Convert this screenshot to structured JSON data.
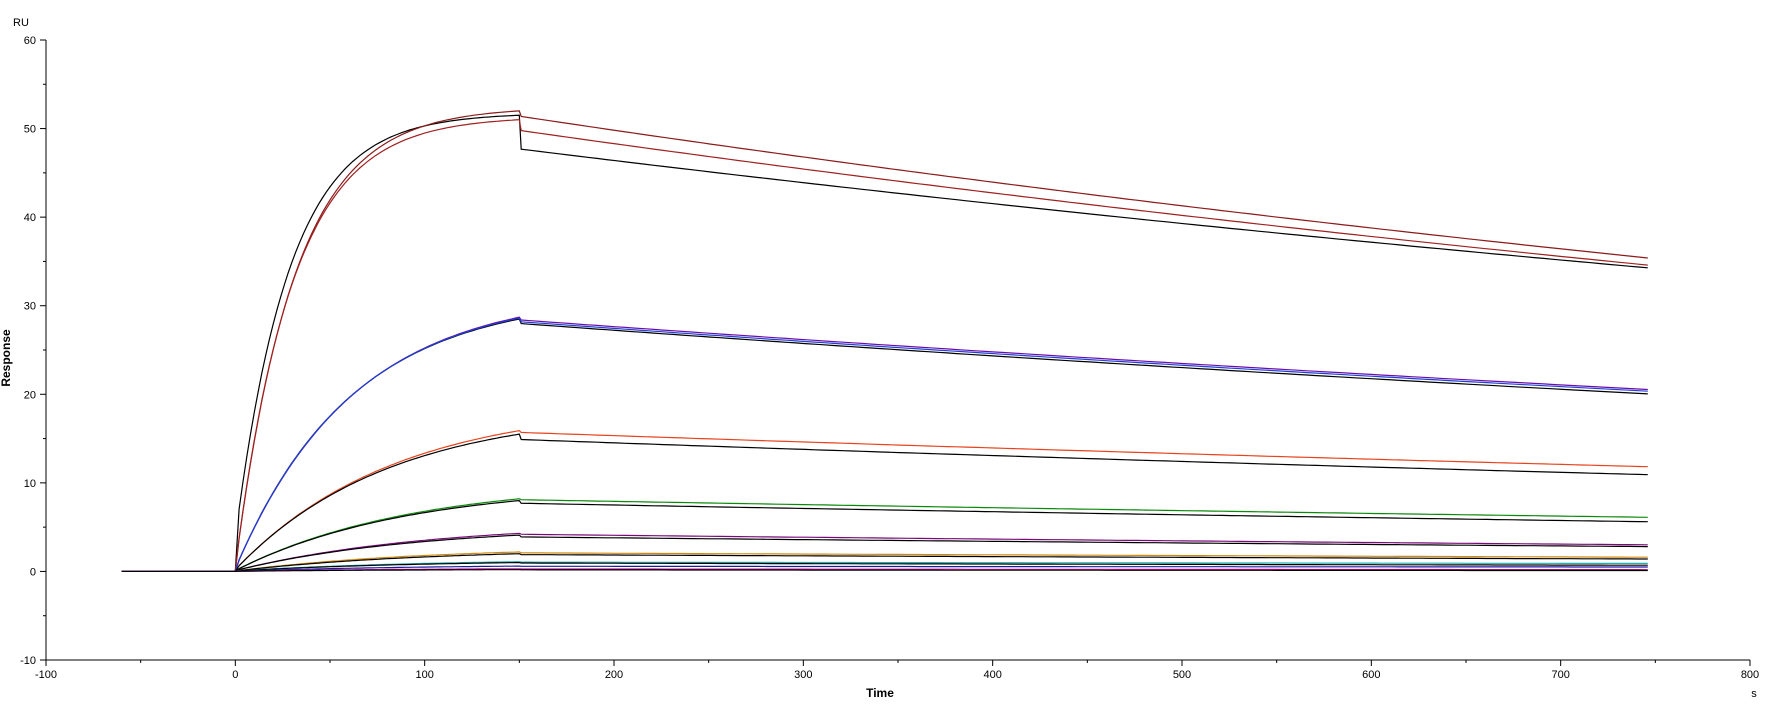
{
  "chart_data": {
    "type": "line",
    "title": "",
    "xlabel": "Time",
    "ylabel": "Response",
    "x_unit": "s",
    "y_unit": "RU",
    "xlim": [
      -100,
      800
    ],
    "ylim": [
      -10,
      60
    ],
    "x_ticks": [
      -100,
      0,
      100,
      200,
      300,
      400,
      500,
      600,
      700,
      800
    ],
    "y_ticks": [
      -10,
      0,
      10,
      20,
      30,
      40,
      50,
      60
    ],
    "grid": false,
    "legend": "none",
    "model": "1:1 binding sensorgram; association 0–150 s, dissociation 150–750 s, baseline from -60 s",
    "series": [
      {
        "color": "#000000",
        "baseline_x": [
          -60,
          0
        ],
        "rmax_fit": 51.5,
        "kobs": 0.0175,
        "jump": 3.8,
        "end_value": 34.2,
        "dip_after_injection": 3.8
      },
      {
        "color": "#8b1a1a",
        "baseline_x": [
          -60,
          0
        ],
        "rmax_fit": 52.0,
        "kobs": 0.016,
        "jump": 0.5,
        "end_value": 35.3,
        "dip_after_injection": 0.6
      },
      {
        "color": "#a02020",
        "baseline_x": [
          -60,
          0
        ],
        "rmax_fit": 51.0,
        "kobs": 0.0165,
        "jump": 0.5,
        "end_value": 34.5,
        "dip_after_injection": 1.2
      },
      {
        "color": "#000000",
        "baseline_x": [
          -60,
          0
        ],
        "rmax_fit": 28.5,
        "kobs": 0.0082,
        "jump": 0.3,
        "end_value": 20.0,
        "dip_after_injection": 0.5
      },
      {
        "color": "#6a0dad",
        "baseline_x": [
          -60,
          0
        ],
        "rmax_fit": 28.7,
        "kobs": 0.008,
        "jump": 0.3,
        "end_value": 20.5,
        "dip_after_injection": 0.3
      },
      {
        "color": "#1f3fd6",
        "baseline_x": [
          -60,
          0
        ],
        "rmax_fit": 28.6,
        "kobs": 0.0081,
        "jump": 0.3,
        "end_value": 20.3,
        "dip_after_injection": 0.4
      },
      {
        "color": "#e8431c",
        "baseline_x": [
          -60,
          0
        ],
        "rmax_fit": 15.9,
        "kobs": 0.006,
        "jump": 0.2,
        "end_value": 11.8,
        "dip_after_injection": 0.2
      },
      {
        "color": "#000000",
        "baseline_x": [
          -60,
          0
        ],
        "rmax_fit": 15.5,
        "kobs": 0.0062,
        "jump": 0.2,
        "end_value": 10.9,
        "dip_after_injection": 0.6
      },
      {
        "color": "#0a8a0a",
        "baseline_x": [
          -60,
          0
        ],
        "rmax_fit": 8.2,
        "kobs": 0.0055,
        "jump": 0.1,
        "end_value": 6.1,
        "dip_after_injection": 0.1
      },
      {
        "color": "#000000",
        "baseline_x": [
          -60,
          0
        ],
        "rmax_fit": 8.0,
        "kobs": 0.0056,
        "jump": 0.1,
        "end_value": 5.6,
        "dip_after_injection": 0.3
      },
      {
        "color": "#7a0a7a",
        "baseline_x": [
          -60,
          0
        ],
        "rmax_fit": 4.3,
        "kobs": 0.005,
        "jump": 0.1,
        "end_value": 3.0,
        "dip_after_injection": 0.1
      },
      {
        "color": "#000000",
        "baseline_x": [
          -60,
          0
        ],
        "rmax_fit": 4.1,
        "kobs": 0.0052,
        "jump": 0.1,
        "end_value": 2.8,
        "dip_after_injection": 0.2
      },
      {
        "color": "#d08a10",
        "baseline_x": [
          -60,
          0
        ],
        "rmax_fit": 2.2,
        "kobs": 0.005,
        "jump": 0.05,
        "end_value": 1.6,
        "dip_after_injection": 0.1
      },
      {
        "color": "#000000",
        "baseline_x": [
          -60,
          0
        ],
        "rmax_fit": 2.0,
        "kobs": 0.005,
        "jump": 0.05,
        "end_value": 1.4,
        "dip_after_injection": 0.1
      },
      {
        "color": "#20b0b0",
        "baseline_x": [
          -60,
          0
        ],
        "rmax_fit": 1.1,
        "kobs": 0.005,
        "jump": 0.05,
        "end_value": 0.9,
        "dip_after_injection": 0.05
      },
      {
        "color": "#000000",
        "baseline_x": [
          -60,
          0
        ],
        "rmax_fit": 1.0,
        "kobs": 0.005,
        "jump": 0.05,
        "end_value": 0.7,
        "dip_after_injection": 0.05
      },
      {
        "color": "#1a1aa0",
        "baseline_x": [
          -60,
          0
        ],
        "rmax_fit": 0.6,
        "kobs": 0.005,
        "jump": 0.02,
        "end_value": 0.5,
        "dip_after_injection": 0.02
      },
      {
        "color": "#c01090",
        "baseline_x": [
          -60,
          0
        ],
        "rmax_fit": 0.3,
        "kobs": 0.005,
        "jump": 0.02,
        "end_value": 0.2,
        "dip_after_injection": 0.02
      },
      {
        "color": "#000000",
        "baseline_x": [
          -60,
          0
        ],
        "rmax_fit": 0.2,
        "kobs": 0.005,
        "jump": 0.02,
        "end_value": 0.1,
        "dip_after_injection": 0.02
      }
    ]
  }
}
